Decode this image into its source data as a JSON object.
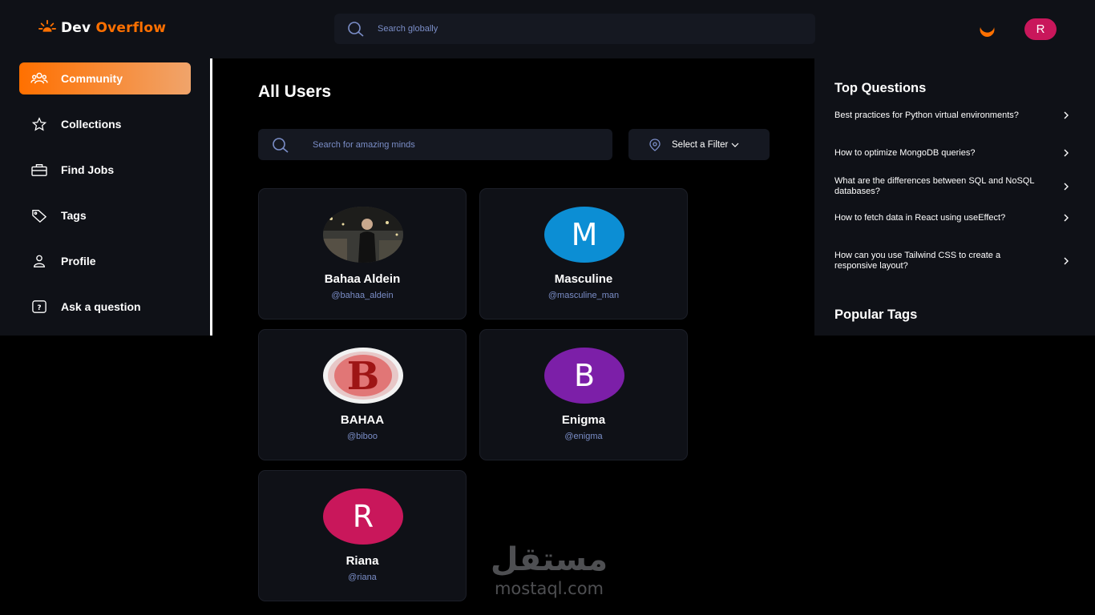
{
  "header": {
    "logo": {
      "part1": "Dev",
      "part2": "Overflow"
    },
    "search_placeholder": "Search globally",
    "user_initial": "R"
  },
  "sidebar": {
    "items": [
      {
        "label": "Community",
        "icon": "users-icon",
        "active": true
      },
      {
        "label": "Collections",
        "icon": "star-icon",
        "active": false
      },
      {
        "label": "Find Jobs",
        "icon": "briefcase-icon",
        "active": false
      },
      {
        "label": "Tags",
        "icon": "tag-icon",
        "active": false
      },
      {
        "label": "Profile",
        "icon": "user-icon",
        "active": false
      },
      {
        "label": "Ask a question",
        "icon": "question-icon",
        "active": false
      }
    ]
  },
  "main": {
    "title": "All Users",
    "search_placeholder": "Search for amazing minds",
    "filter_label": "Select a Filter",
    "users": [
      {
        "name": "Bahaa Aldein",
        "handle": "@bahaa_aldein",
        "avatar": "photo",
        "initial": ""
      },
      {
        "name": "Masculine",
        "handle": "@masculine_man",
        "avatar": "initial",
        "initial": "M",
        "color": "#0c8ed4"
      },
      {
        "name": "BAHAA",
        "handle": "@biboo",
        "avatar": "logo-b",
        "initial": "B"
      },
      {
        "name": "Enigma",
        "handle": "@enigma",
        "avatar": "initial",
        "initial": "B",
        "color": "#7c1fa8"
      },
      {
        "name": "Riana",
        "handle": "@riana",
        "avatar": "initial",
        "initial": "R",
        "color": "#c9175b"
      }
    ]
  },
  "rightbar": {
    "top_questions_title": "Top Questions",
    "questions": [
      "Best practices for Python virtual environments?",
      "How to optimize MongoDB queries?",
      "What are the differences between SQL and NoSQL databases?",
      "How to fetch data in React using useEffect?",
      "How can you use Tailwind CSS to create a responsive layout?"
    ],
    "popular_tags_title": "Popular Tags"
  },
  "watermark": {
    "arabic": "مستقل",
    "latin": "mostaql.com"
  },
  "colors": {
    "accent": "#ff7000",
    "panel": "#0f1117",
    "input": "#151821",
    "link": "#7b8ec8"
  }
}
